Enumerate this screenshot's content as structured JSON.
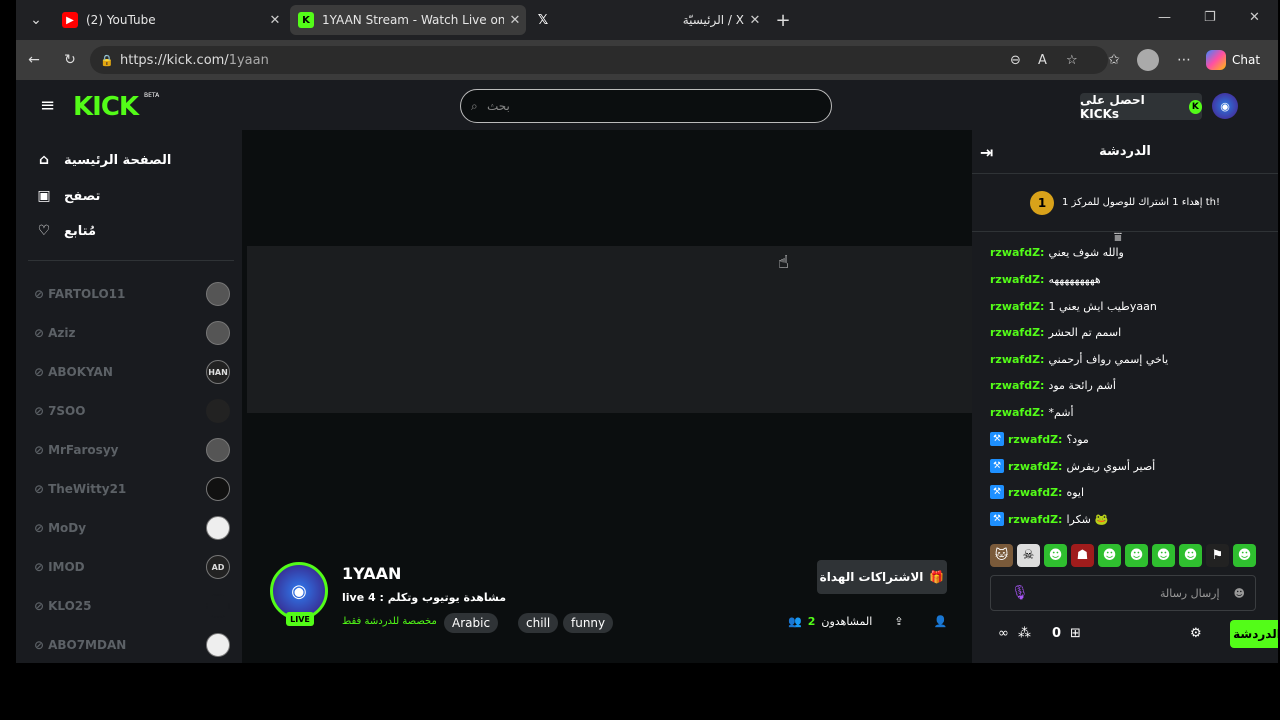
{
  "browser": {
    "tabs": [
      {
        "title": "(2) YouTube",
        "icon": "youtube-icon"
      },
      {
        "title": "1YAAN Stream - Watch Live on Kic",
        "icon": "kick-icon"
      },
      {
        "title": "",
        "icon": "x-icon"
      },
      {
        "title": "الرئيسيّة / X",
        "icon": "x-icon"
      }
    ],
    "url_host": "https://kick.com/",
    "url_path": "1yaan",
    "chat_label": "Chat"
  },
  "header": {
    "logo": "KICK",
    "beta": "BETA",
    "search_placeholder": "بحث",
    "kicks_button": "احصل على KICKs"
  },
  "sidebar": {
    "nav": [
      {
        "label": "الصفحة الرئيسية",
        "icon": "home-icon"
      },
      {
        "label": "تصفح",
        "icon": "browse-icon"
      },
      {
        "label": "مُتابع",
        "icon": "heart-icon"
      }
    ],
    "channels": [
      {
        "name": "FARTOLO11"
      },
      {
        "name": "Aziz"
      },
      {
        "name": "ABOKYAN",
        "avatar_text": "HAN"
      },
      {
        "name": "7SOO"
      },
      {
        "name": "MrFarosyy"
      },
      {
        "name": "TheWitty21"
      },
      {
        "name": "MoDy"
      },
      {
        "name": "IMOD",
        "avatar_text": "AD"
      },
      {
        "name": "KLO25"
      },
      {
        "name": "ABO7MDAN"
      }
    ]
  },
  "stream": {
    "channel_name": "1YAAN",
    "live_badge": "LIVE",
    "title": "live 4 : مشاهدة يوتيوب وتكلم",
    "category": "مخصصة للدردشة فقط",
    "tags": [
      "Arabic",
      "chill",
      "funny"
    ],
    "gift_button": "الاشتراكات الهداة",
    "viewers_label": "المشاهدون",
    "viewers_count": "2"
  },
  "chat": {
    "title": "الدردشة",
    "pinned_text": "إهداء 1 اشتراك للوصول للمركز 1 th!",
    "pinned_rank": "1",
    "messages": [
      {
        "user": "rzwafdZ:",
        "text": "والله شوف يعني",
        "badge": false
      },
      {
        "user": "rzwafdZ:",
        "text": "هههههههههه",
        "badge": false
      },
      {
        "user": "rzwafdZ:",
        "text": "طيب ايش يعني 1yaan",
        "badge": false
      },
      {
        "user": "rzwafdZ:",
        "text": "اسمم تم الحشر",
        "badge": false
      },
      {
        "user": "rzwafdZ:",
        "text": "ياخي إسمي رواف أرحمني",
        "badge": false
      },
      {
        "user": "rzwafdZ:",
        "text": "أشم رائحة مود",
        "badge": false
      },
      {
        "user": "rzwafdZ:",
        "text": "*أشم",
        "badge": false
      },
      {
        "user": "rzwafdZ:",
        "text": "مود؟",
        "badge": true
      },
      {
        "user": "rzwafdZ:",
        "text": "أصير أسوي ريفرش",
        "badge": true
      },
      {
        "user": "rzwafdZ:",
        "text": "ايوه",
        "badge": true
      },
      {
        "user": "rzwafdZ:",
        "text": "شكرا",
        "badge": true
      }
    ],
    "input_placeholder": "إرسال رسالة",
    "send_button": "الدردشة",
    "points": "0"
  }
}
